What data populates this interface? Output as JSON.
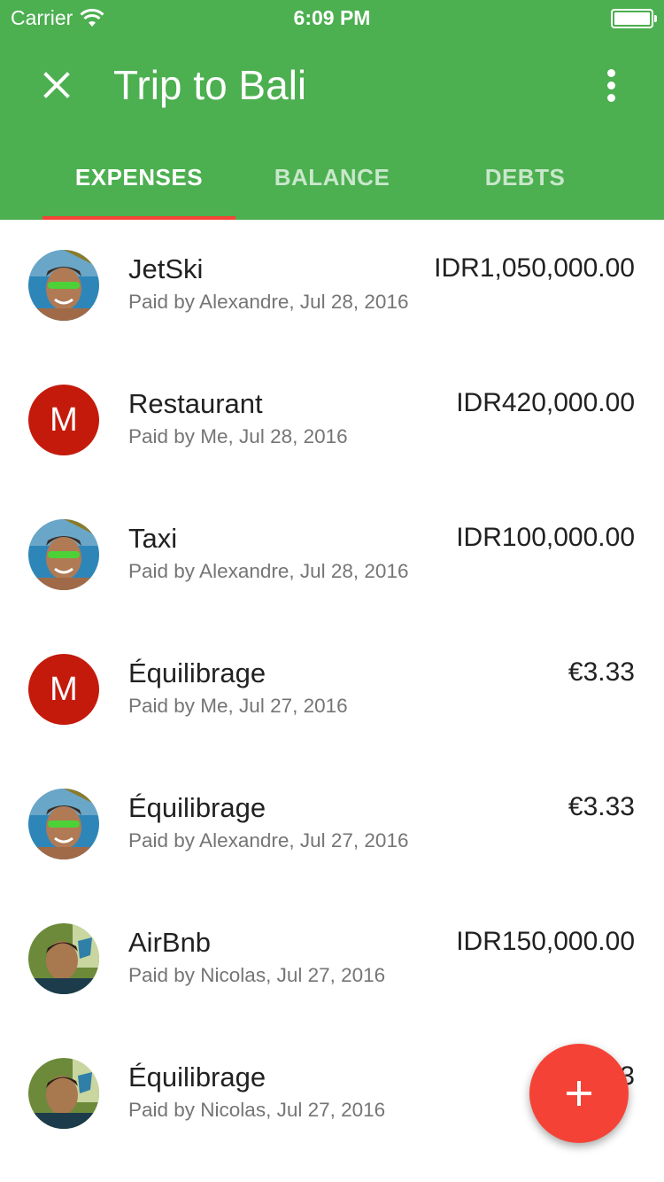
{
  "status": {
    "carrier": "Carrier",
    "time": "6:09 PM"
  },
  "toolbar": {
    "title": "Trip to Bali",
    "close_icon": "close-icon",
    "more_icon": "more-vert-icon"
  },
  "tabs": [
    {
      "label": "EXPENSES",
      "active": true
    },
    {
      "label": "BALANCE",
      "active": false
    },
    {
      "label": "DEBTS",
      "active": false
    }
  ],
  "colors": {
    "primary": "#4caf50",
    "accent": "#f44336",
    "avatar_letter_bg": "#c41a0c"
  },
  "expenses": [
    {
      "title": "JetSki",
      "subtitle": "Paid by Alexandre, Jul 28, 2016",
      "amount": "IDR1,050,000.00",
      "avatar": "alexandre"
    },
    {
      "title": "Restaurant",
      "subtitle": "Paid by Me, Jul 28, 2016",
      "amount": "IDR420,000.00",
      "avatar": "letter",
      "letter": "M"
    },
    {
      "title": "Taxi",
      "subtitle": "Paid by Alexandre, Jul 28, 2016",
      "amount": "IDR100,000.00",
      "avatar": "alexandre"
    },
    {
      "title": "Équilibrage",
      "subtitle": "Paid by Me, Jul 27, 2016",
      "amount": "€3.33",
      "avatar": "letter",
      "letter": "M"
    },
    {
      "title": "Équilibrage",
      "subtitle": "Paid by Alexandre, Jul 27, 2016",
      "amount": "€3.33",
      "avatar": "alexandre"
    },
    {
      "title": "AirBnb",
      "subtitle": "Paid by Nicolas, Jul 27, 2016",
      "amount": "IDR150,000.00",
      "avatar": "nicolas"
    },
    {
      "title": "Équilibrage",
      "subtitle": "Paid by Nicolas, Jul 27, 2016",
      "amount": "€3.33",
      "avatar": "nicolas"
    }
  ],
  "fab": {
    "icon": "plus-icon"
  }
}
